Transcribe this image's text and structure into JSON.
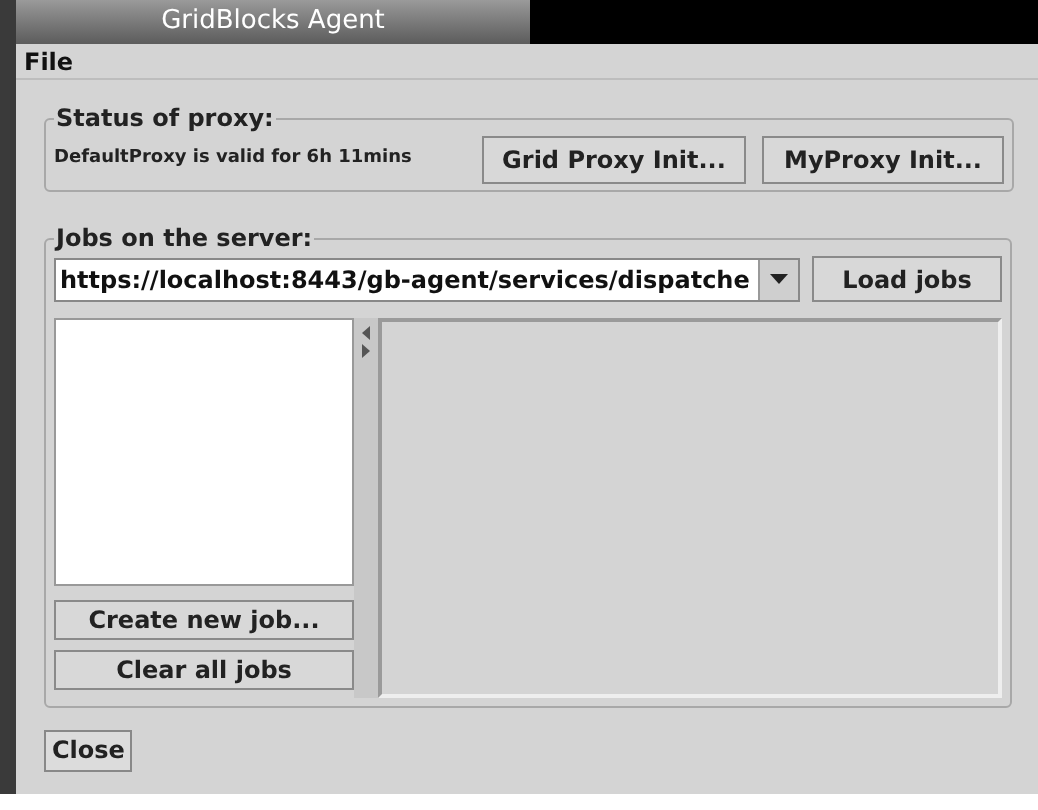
{
  "window": {
    "title": "GridBlocks Agent"
  },
  "menu": [
    "File"
  ],
  "proxy_group": {
    "title": "Status of proxy:",
    "status": "DefaultProxy is valid for 6h 11mins",
    "buttons": [
      "Grid Proxy Init...",
      "MyProxy Init..."
    ]
  },
  "jobs_group": {
    "title": "Jobs on the server:",
    "server_url": "https://localhost:8443/gb-agent/services/dispatche",
    "load_button": "Load jobs",
    "buttons": [
      "Create new job...",
      "Clear all jobs"
    ]
  },
  "close_button": "Close"
}
